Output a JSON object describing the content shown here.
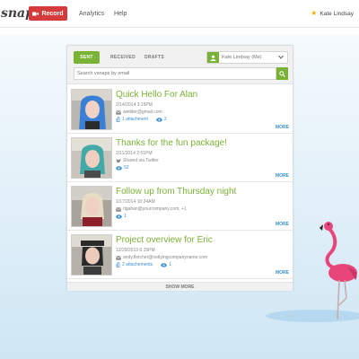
{
  "header": {
    "logo_text": "snap",
    "record_label": "Record",
    "nav": {
      "analytics": "Analytics",
      "help": "Help"
    },
    "user_name": "Kate Lindsay"
  },
  "panel": {
    "tabs": {
      "sent": "SENT",
      "received": "RECEIVED",
      "drafts": "DRAFTS"
    },
    "active_tab": "SENT",
    "account": "Kate Lindsay (Me)",
    "search_placeholder": "Search vsnaps by email",
    "show_more": "SHOW MORE"
  },
  "vsnaps": [
    {
      "title": "Quick Hello For Alan",
      "date": "2/14/2014  3:15PM",
      "recipient_icon": "envelope-icon",
      "recipient": "awilder@gmail.com",
      "attachments": "1 attachment",
      "views": "2",
      "more": "MORE",
      "hair": "#3a7fd6"
    },
    {
      "title": "Thanks for the fun package!",
      "date": "2/11/2014  2:51PM",
      "recipient_icon": "twitter-icon",
      "recipient": "Shared via Twitter",
      "attachments": "",
      "views": "52",
      "more": "MORE",
      "hair": "#43a8a8"
    },
    {
      "title": "Follow up from Thursday night",
      "date": "1/17/2014  10:24AM",
      "recipient_icon": "envelope-icon",
      "recipient": "rlgahan@yourcompany.com, +1",
      "attachments": "",
      "views": "1",
      "more": "MORE",
      "hair": "#e9dcc4"
    },
    {
      "title": "Project overview for Eric",
      "date": "12/29/2013  6:15PM",
      "recipient_icon": "envelope-icon",
      "recipient": "andy.fletcher@notlyingcompanyname.com",
      "attachments": "2 attachements",
      "views": "1",
      "more": "MORE",
      "hair": "#2a2a2a"
    }
  ],
  "colors": {
    "accent_green": "#7ab235",
    "record_red": "#d63b3b",
    "link_blue": "#3a8fd0",
    "flamingo_pink": "#e8457a"
  }
}
